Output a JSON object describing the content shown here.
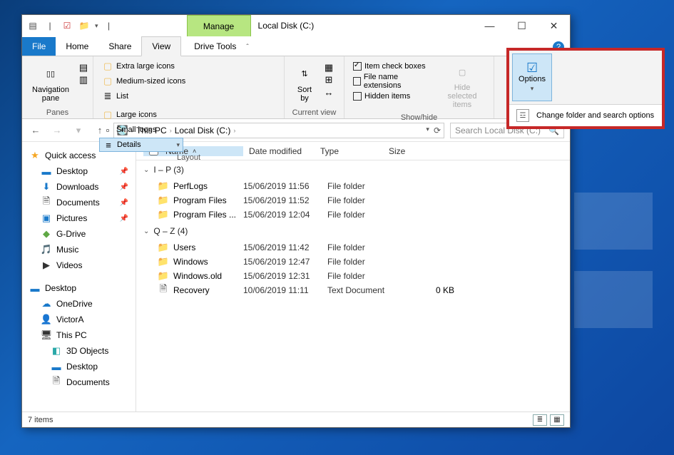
{
  "titlebar": {
    "manage": "Manage",
    "title": "Local Disk (C:)",
    "min": "—",
    "max": "☐",
    "close": "✕"
  },
  "tabs": {
    "file": "File",
    "home": "Home",
    "share": "Share",
    "view": "View",
    "drive": "Drive Tools"
  },
  "ribbon": {
    "panes_label": "Panes",
    "navpane": "Navigation\npane",
    "layout_label": "Layout",
    "layout": {
      "xl": "Extra large icons",
      "lg": "Large icons",
      "med": "Medium-sized icons",
      "sm": "Small icons",
      "list": "List",
      "details": "Details"
    },
    "current_label": "Current view",
    "sort": "Sort\nby",
    "show_label": "Show/hide",
    "show": {
      "item": "Item check boxes",
      "ext": "File name extensions",
      "hidden": "Hidden items",
      "hide": "Hide selected\nitems"
    }
  },
  "popover": {
    "options": "Options",
    "change": "Change folder and search options"
  },
  "address": {
    "thispc": "This PC",
    "loc": "Local Disk (C:)"
  },
  "search": {
    "placeholder": "Search Local Disk (C:)"
  },
  "side": {
    "quick": "Quick access",
    "desktop": "Desktop",
    "downloads": "Downloads",
    "documents": "Documents",
    "pictures": "Pictures",
    "gdrive": "G-Drive",
    "music": "Music",
    "videos": "Videos",
    "desktop2": "Desktop",
    "onedrive": "OneDrive",
    "user": "VictorA",
    "thispc": "This PC",
    "obj3d": "3D Objects",
    "desk3": "Desktop",
    "docs3": "Documents"
  },
  "columns": {
    "name": "Name",
    "date": "Date modified",
    "type": "Type",
    "size": "Size"
  },
  "groups": [
    {
      "label": "I – P (3)",
      "items": [
        {
          "name": "PerfLogs",
          "date": "15/06/2019 11:56",
          "type": "File folder",
          "size": "",
          "icon": "folder"
        },
        {
          "name": "Program Files",
          "date": "15/06/2019 11:52",
          "type": "File folder",
          "size": "",
          "icon": "folder"
        },
        {
          "name": "Program Files ...",
          "date": "15/06/2019 12:04",
          "type": "File folder",
          "size": "",
          "icon": "folder"
        }
      ]
    },
    {
      "label": "Q – Z (4)",
      "items": [
        {
          "name": "Users",
          "date": "15/06/2019 11:42",
          "type": "File folder",
          "size": "",
          "icon": "folder"
        },
        {
          "name": "Windows",
          "date": "15/06/2019 12:47",
          "type": "File folder",
          "size": "",
          "icon": "folder"
        },
        {
          "name": "Windows.old",
          "date": "15/06/2019 12:31",
          "type": "File folder",
          "size": "",
          "icon": "folder"
        },
        {
          "name": "Recovery",
          "date": "10/06/2019 11:11",
          "type": "Text Document",
          "size": "0 KB",
          "icon": "file"
        }
      ]
    }
  ],
  "status": {
    "count": "7 items"
  }
}
